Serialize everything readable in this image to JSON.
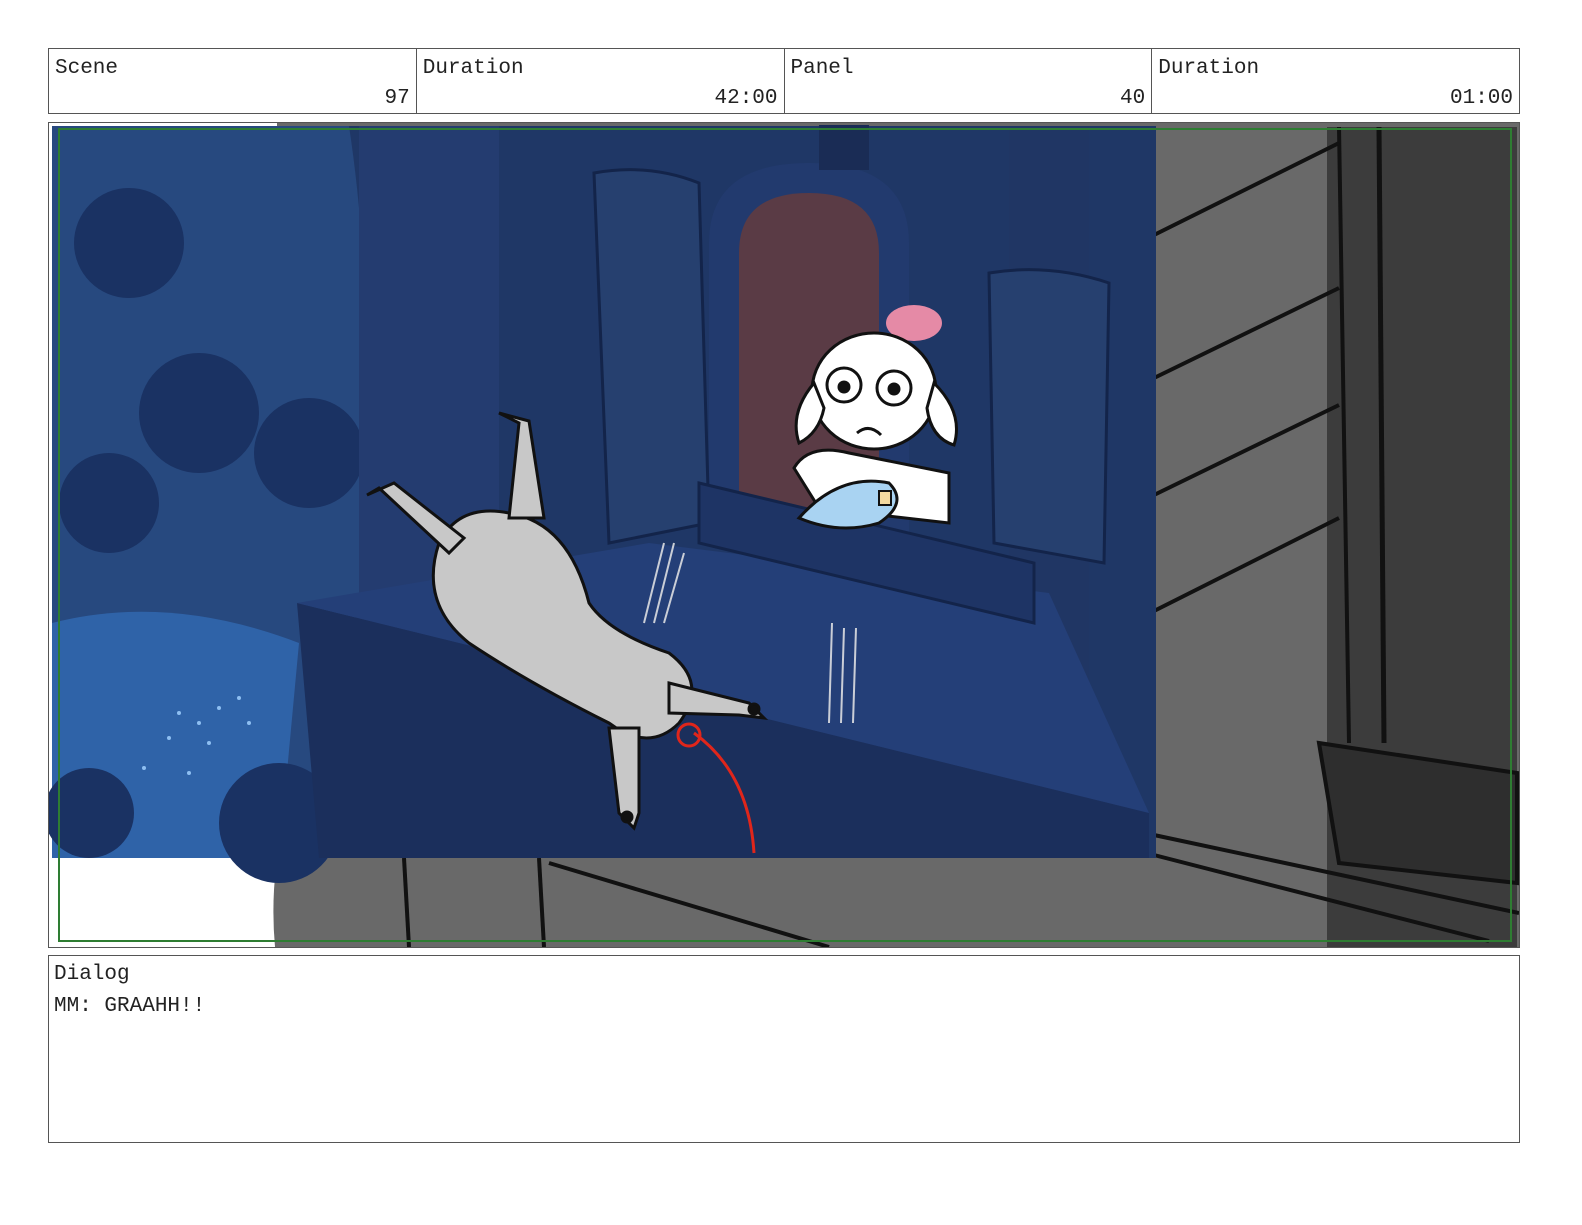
{
  "header": {
    "scene_label": "Scene",
    "scene_value": "97",
    "scene_duration_label": "Duration",
    "scene_duration_value": "42:00",
    "panel_label": "Panel",
    "panel_value": "40",
    "panel_duration_label": "Duration",
    "panel_duration_value": "01:00"
  },
  "panel_image": {
    "description_icon": "storyboard-drawing",
    "colors": {
      "night_blue": "#1f3766",
      "deep_blue": "#162a55",
      "grey_layer": "#696969",
      "dark_grey": "#3c3c3c",
      "safe_frame": "#2e7d32",
      "motion_arrow": "#e0261b",
      "window_glow": "#e58aa6"
    }
  },
  "dialog": {
    "label": "Dialog",
    "text": "MM: GRAAHH!!"
  }
}
